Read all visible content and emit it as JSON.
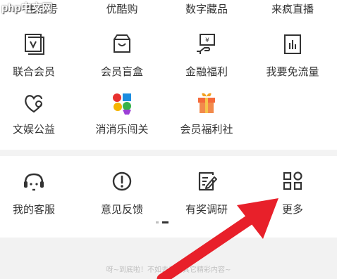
{
  "watermark": "php中文网",
  "top_row": [
    {
      "label": "生活号"
    },
    {
      "label": "优酷购"
    },
    {
      "label": "数字藏品"
    },
    {
      "label": "来疯直播"
    }
  ],
  "services": [
    {
      "label": "联合会员",
      "icon": "member-card-icon"
    },
    {
      "label": "会员盲盒",
      "icon": "mystery-box-icon"
    },
    {
      "label": "金融福利",
      "icon": "finance-icon"
    },
    {
      "label": "我要免流量",
      "icon": "data-traffic-icon"
    },
    {
      "label": "文娱公益",
      "icon": "charity-heart-icon"
    },
    {
      "label": "消消乐闯关",
      "icon": "candy-game-icon"
    },
    {
      "label": "会员福利社",
      "icon": "gift-icon"
    }
  ],
  "support": [
    {
      "label": "我的客服",
      "icon": "customer-service-icon"
    },
    {
      "label": "意见反馈",
      "icon": "feedback-icon"
    },
    {
      "label": "有奖调研",
      "icon": "survey-icon"
    },
    {
      "label": "更多",
      "icon": "more-grid-icon"
    }
  ],
  "footer": {
    "text": "呀~到底啦！不如去看看其它精彩内容~"
  },
  "colors": {
    "icon_stroke": "#333333",
    "arrow": "#e8202a",
    "footer_bg": "#f2f2f2"
  }
}
